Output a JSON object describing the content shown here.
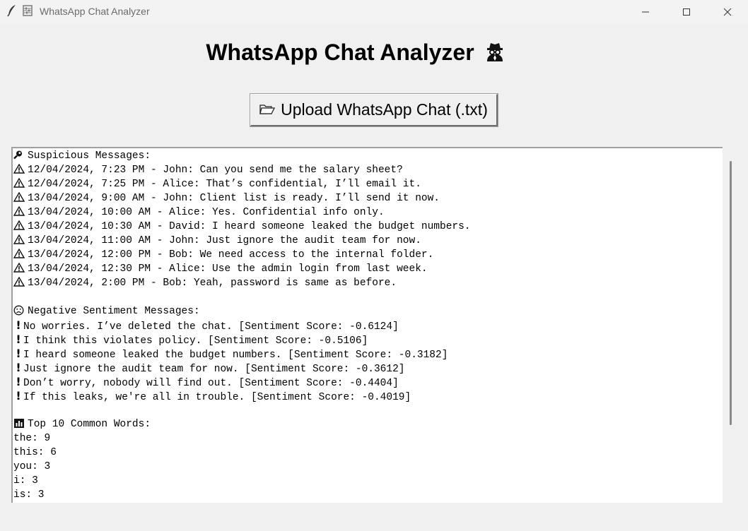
{
  "window": {
    "title": "WhatsApp Chat Analyzer"
  },
  "header": {
    "title": "WhatsApp Chat Analyzer",
    "title_icon": "spy-icon"
  },
  "upload_button": {
    "label": "Upload WhatsApp Chat (.txt)",
    "icon": "folder-open-icon"
  },
  "output": {
    "suspicious": {
      "heading": "Suspicious Messages:",
      "icon": "magnifier-icon",
      "items": [
        "12/04/2024, 7:23 PM - John: Can you send me the salary sheet?",
        "12/04/2024, 7:25 PM - Alice: That’s confidential, I’ll email it.",
        "13/04/2024, 9:00 AM - John: Client list is ready. I’ll send it now.",
        "13/04/2024, 10:00 AM - Alice: Yes. Confidential info only.",
        "13/04/2024, 10:30 AM - David: I heard someone leaked the budget numbers.",
        "13/04/2024, 11:00 AM - John: Just ignore the audit team for now.",
        "13/04/2024, 12:00 PM - Bob: We need access to the internal folder.",
        "13/04/2024, 12:30 PM - Alice: Use the admin login from last week.",
        "13/04/2024, 2:00 PM - Bob: Yeah, password is same as before."
      ]
    },
    "negative": {
      "heading": "Negative Sentiment Messages:",
      "icon": "frowning-face-icon",
      "items": [
        "No worries. I’ve deleted the chat. [Sentiment Score: -0.6124]",
        "I think this violates policy. [Sentiment Score: -0.5106]",
        "I heard someone leaked the budget numbers. [Sentiment Score: -0.3182]",
        "Just ignore the audit team for now. [Sentiment Score: -0.3612]",
        "Don’t worry, nobody will find out. [Sentiment Score: -0.4404]",
        "If this leaks, we're all in trouble. [Sentiment Score: -0.4019]"
      ]
    },
    "common_words": {
      "heading": "Top 10 Common Words:",
      "icon": "bar-chart-icon",
      "items": [
        "the: 9",
        "this: 6",
        "you: 3",
        "i: 3",
        "is: 3"
      ]
    }
  }
}
